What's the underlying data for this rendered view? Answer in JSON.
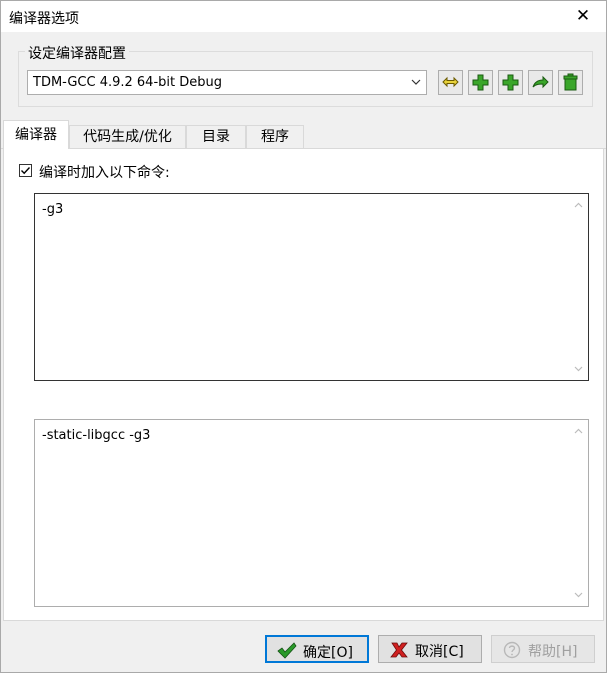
{
  "window": {
    "title": "编译器选项",
    "close_glyph": "✕"
  },
  "compiler_set": {
    "group_label": "设定编译器配置",
    "selected": "TDM-GCC 4.9.2 64-bit Debug",
    "toolbar_icons": [
      "compiler-find-icon",
      "add-compiler-icon",
      "add-compiler-icon",
      "rename-compiler-icon",
      "delete-compiler-icon"
    ]
  },
  "tabs": [
    {
      "label": "编译器",
      "active": true
    },
    {
      "label": "代码生成/优化",
      "active": false
    },
    {
      "label": "目录",
      "active": false
    },
    {
      "label": "程序",
      "active": false
    }
  ],
  "compiler_tab": {
    "checkbox_label": "编译时加入以下命令:",
    "checkbox_checked": true,
    "compile_commands": "-g3",
    "linker_commands": "-static-libgcc -g3"
  },
  "buttons": {
    "ok": "确定[O]",
    "cancel": "取消[C]",
    "help": "帮助[H]"
  },
  "colors": {
    "accent": "#0078d7",
    "ok_icon": "#2a9a2a",
    "cancel_icon": "#d02020",
    "plus_icon": "#3aa62a"
  }
}
